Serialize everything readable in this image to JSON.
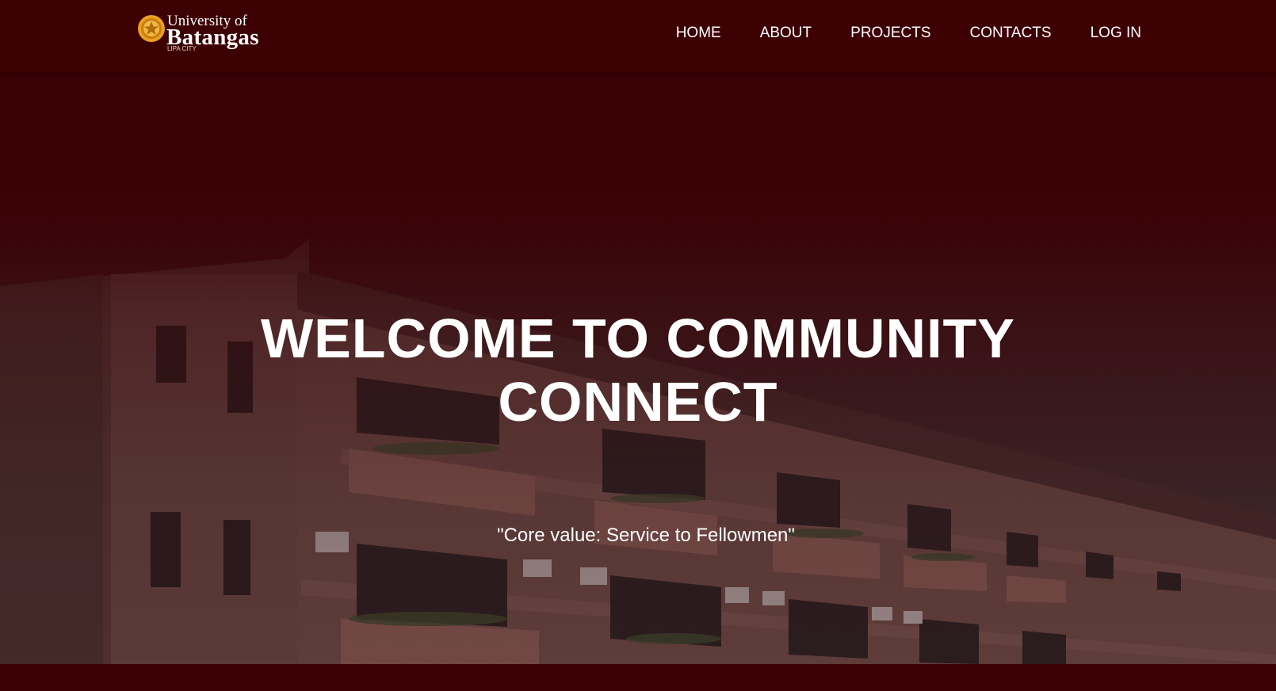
{
  "brand": {
    "line1": "University of",
    "line2": "Batangas",
    "line3": "LIPA CITY",
    "seal_color": "#e8a020"
  },
  "nav": {
    "items": [
      {
        "label": "HOME"
      },
      {
        "label": "ABOUT"
      },
      {
        "label": "PROJECTS"
      },
      {
        "label": "CONTACTS"
      },
      {
        "label": "LOG IN"
      }
    ]
  },
  "hero": {
    "title_line1": "WELCOME TO COMMUNITY",
    "title_line2": "CONNECT",
    "subtitle": "\"Core value: Service to Fellowmen\""
  },
  "colors": {
    "primary": "#3d0104",
    "text": "#ffffff"
  }
}
